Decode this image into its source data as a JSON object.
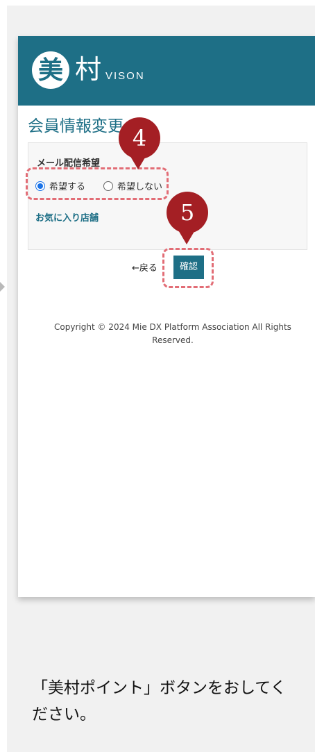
{
  "header": {
    "logo_circle_char": "美",
    "logo_kanji": "村",
    "logo_text": "VISON"
  },
  "page": {
    "title": "会員情報変更"
  },
  "form": {
    "mail_label": "メール配信希望",
    "radio_yes": "希望する",
    "radio_no": "希望しない",
    "selected": "希望する",
    "favorite_shops_link": "お気に入り店舗"
  },
  "buttons": {
    "back_label": "←戻る",
    "confirm_label": "確認"
  },
  "footer": {
    "copyright": "Copyright © 2024 Mie DX Platform Association All Rights Reserved."
  },
  "annotations": {
    "marker_4": "4",
    "marker_5": "5",
    "highlight_color": "#e26d76",
    "marker_color": "#a41f24"
  },
  "instruction": {
    "text": "「美村ポイント」ボタンをおしてください。"
  },
  "colors": {
    "brand": "#1e6f86",
    "radio_accent": "#1a73e8"
  }
}
